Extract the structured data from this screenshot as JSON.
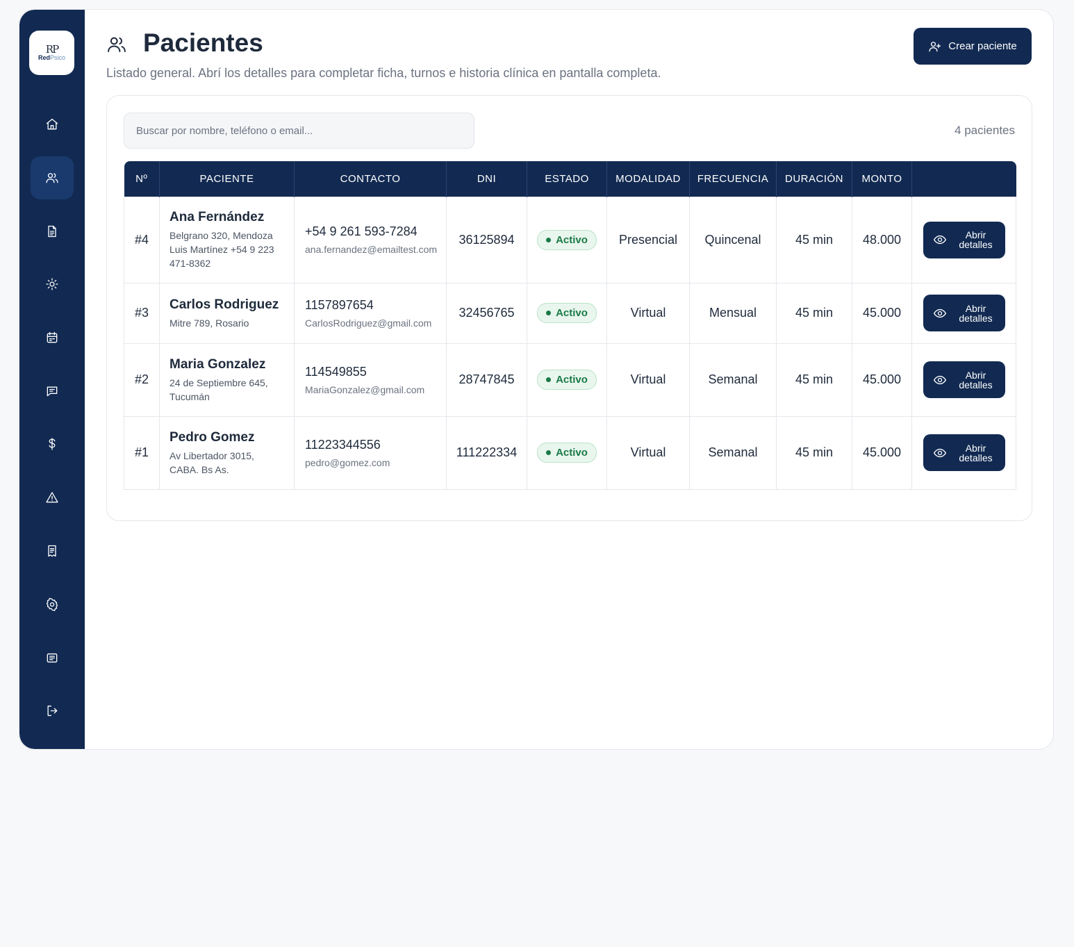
{
  "brand": {
    "mark": "RP",
    "name_a": "Red",
    "name_b": "Psico"
  },
  "sidebar": {
    "items": [
      {
        "name": "home",
        "icon": "home-icon"
      },
      {
        "name": "patients",
        "icon": "users-icon",
        "active": true
      },
      {
        "name": "documents",
        "icon": "file-icon"
      },
      {
        "name": "sun",
        "icon": "sun-icon"
      },
      {
        "name": "calendar",
        "icon": "calendar-icon"
      },
      {
        "name": "messages",
        "icon": "message-icon"
      },
      {
        "name": "payments",
        "icon": "dollar-icon"
      },
      {
        "name": "alerts",
        "icon": "alert-icon"
      },
      {
        "name": "receipts",
        "icon": "receipt-icon"
      },
      {
        "name": "settings",
        "icon": "gear-icon"
      },
      {
        "name": "notes",
        "icon": "notes-icon"
      },
      {
        "name": "logout",
        "icon": "logout-icon"
      }
    ]
  },
  "header": {
    "title": "Pacientes",
    "subtitle": "Listado general. Abrí los detalles para completar ficha, turnos e historia clínica en pantalla completa.",
    "create_button": "Crear paciente"
  },
  "search": {
    "placeholder": "Buscar por nombre, teléfono o email...",
    "value": ""
  },
  "count_label": "4 pacientes",
  "table": {
    "columns": [
      "Nº",
      "PACIENTE",
      "CONTACTO",
      "DNI",
      "ESTADO",
      "MODALIDAD",
      "FRECUENCIA",
      "DURACIÓN",
      "MONTO",
      ""
    ],
    "action_label": "Abrir detalles",
    "rows": [
      {
        "num": "#4",
        "name": "Ana Fernández",
        "address": "Belgrano 320, Mendoza Luis Martínez +54 9 223 471-8362",
        "phone": "+54 9 261 593-7284",
        "email": "ana.fernandez@emailtest.com",
        "dni": "36125894",
        "estado": "Activo",
        "modalidad": "Presencial",
        "frecuencia": "Quincenal",
        "duracion": "45 min",
        "monto": "48.000"
      },
      {
        "num": "#3",
        "name": "Carlos Rodriguez",
        "address": "Mitre 789, Rosario",
        "phone": "1157897654",
        "email": "CarlosRodriguez@gmail.com",
        "dni": "32456765",
        "estado": "Activo",
        "modalidad": "Virtual",
        "frecuencia": "Mensual",
        "duracion": "45 min",
        "monto": "45.000"
      },
      {
        "num": "#2",
        "name": "Maria Gonzalez",
        "address": "24 de Septiembre 645, Tucumán",
        "phone": "114549855",
        "email": "MariaGonzalez@gmail.com",
        "dni": "28747845",
        "estado": "Activo",
        "modalidad": "Virtual",
        "frecuencia": "Semanal",
        "duracion": "45 min",
        "monto": "45.000"
      },
      {
        "num": "#1",
        "name": "Pedro Gomez",
        "address": "Av Libertador 3015, CABA. Bs As.",
        "phone": "11223344556",
        "email": "pedro@gomez.com",
        "dni": "111222334",
        "estado": "Activo",
        "modalidad": "Virtual",
        "frecuencia": "Semanal",
        "duracion": "45 min",
        "monto": "45.000"
      }
    ]
  },
  "colors": {
    "navy": "#122a52",
    "active_green": "#1a7a46",
    "badge_bg": "#e9f6ee",
    "muted": "#6b7280"
  }
}
